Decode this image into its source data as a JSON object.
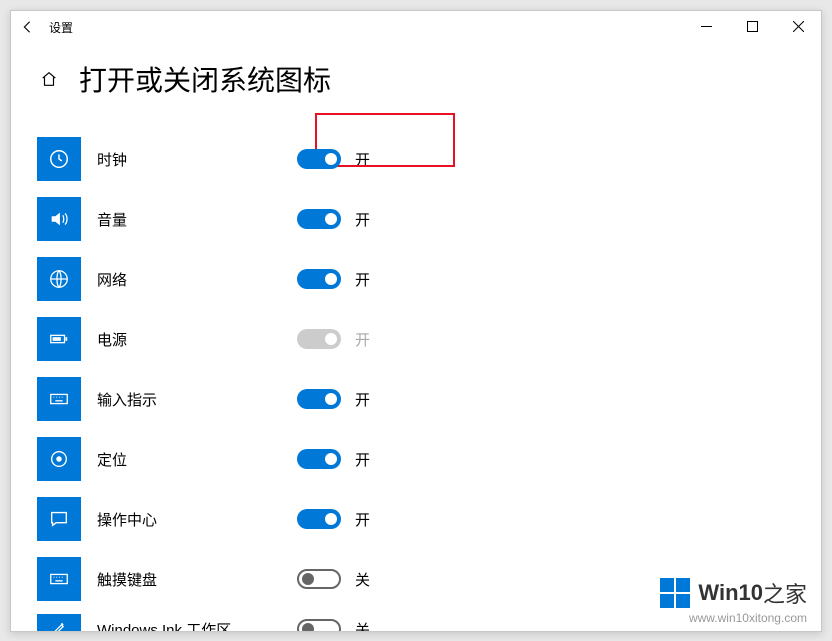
{
  "app_title": "设置",
  "page_title": "打开或关闭系统图标",
  "state_on": "开",
  "state_off": "关",
  "items": [
    {
      "id": "clock",
      "label": "时钟",
      "state": "on",
      "enabled": true
    },
    {
      "id": "volume",
      "label": "音量",
      "state": "on",
      "enabled": true
    },
    {
      "id": "network",
      "label": "网络",
      "state": "on",
      "enabled": true
    },
    {
      "id": "power",
      "label": "电源",
      "state": "on",
      "enabled": false
    },
    {
      "id": "input",
      "label": "输入指示",
      "state": "on",
      "enabled": true
    },
    {
      "id": "location",
      "label": "定位",
      "state": "on",
      "enabled": true
    },
    {
      "id": "action",
      "label": "操作中心",
      "state": "on",
      "enabled": true
    },
    {
      "id": "touchkb",
      "label": "触摸键盘",
      "state": "off",
      "enabled": true
    },
    {
      "id": "ink",
      "label": "Windows Ink 工作区",
      "state": "off",
      "enabled": true
    }
  ],
  "watermark": {
    "brand1": "Win10",
    "brand2": "之家",
    "url": "www.win10xitong.com"
  },
  "colors": {
    "accent": "#0078d7"
  }
}
